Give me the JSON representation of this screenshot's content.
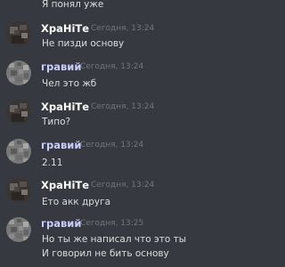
{
  "colors": {
    "background": "#36393f",
    "username_a": "#ffffff",
    "username_b": "#c9cdfb",
    "timestamp": "#72767d",
    "message_text": "#dcddde"
  },
  "messages": [
    {
      "author": "",
      "timestamp": "",
      "lines": [
        "Я понял уже"
      ]
    },
    {
      "author": "ХраНiТе",
      "avatar": "dark-avatar",
      "timestamp": "Сегодня, 13:24",
      "lines": [
        "Не пизди основу"
      ]
    },
    {
      "author": "гравий",
      "avatar": "gravel-avatar",
      "timestamp": "Сегодня, 13:24",
      "lines": [
        "Чел это жб"
      ]
    },
    {
      "author": "ХраНiТе",
      "avatar": "dark-avatar",
      "timestamp": "Сегодня, 13:24",
      "lines": [
        "Типо?"
      ]
    },
    {
      "author": "гравий",
      "avatar": "gravel-avatar",
      "timestamp": "Сегодня, 13:24",
      "lines": [
        "2.11"
      ]
    },
    {
      "author": "ХраНiТе",
      "avatar": "dark-avatar",
      "timestamp": "Сегодня, 13:24",
      "lines": [
        "Ето акк друга"
      ]
    },
    {
      "author": "гравий",
      "avatar": "gravel-avatar",
      "timestamp": "Сегодня, 13:25",
      "lines": [
        "Но ты же написал что это ты",
        "И говорил не бить основу"
      ]
    }
  ]
}
